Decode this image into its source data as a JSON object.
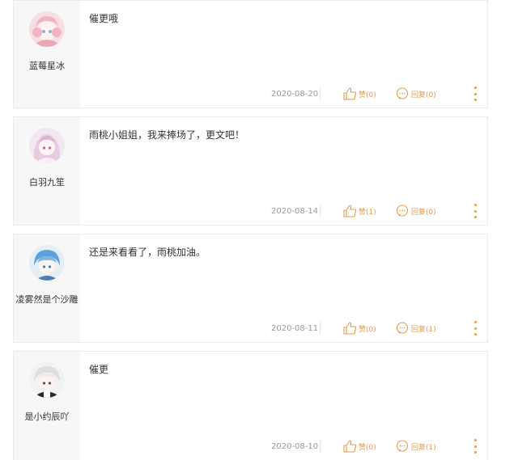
{
  "comments": [
    {
      "username": "蓝莓星冰",
      "content": "催更哦",
      "date": "2020-08-20",
      "like_label": "赞(0)",
      "reply_label": "回复(0)",
      "avatar": "pink-anime-girl-avatar"
    },
    {
      "username": "白羽九笙",
      "content": "雨桃小姐姐，我来捧场了，更文吧！",
      "date": "2020-08-14",
      "like_label": "赞(1)",
      "reply_label": "回复(0)",
      "avatar": "lilac-anime-girl-avatar"
    },
    {
      "username": "凌雾然是个沙雕",
      "content": "还是来看看了，雨桃加油。",
      "date": "2020-08-11",
      "like_label": "赞(0)",
      "reply_label": "回复(1)",
      "avatar": "blue-anime-boy-avatar"
    },
    {
      "username": "是小约辰吖",
      "content": "催更",
      "date": "2020-08-10",
      "like_label": "赞(0)",
      "reply_label": "回复(1)",
      "avatar": "white-hair-anime-avatar"
    }
  ],
  "colors": {
    "accent": "#e79a45",
    "date": "#999999",
    "sidebar": "#f7f7f7"
  }
}
